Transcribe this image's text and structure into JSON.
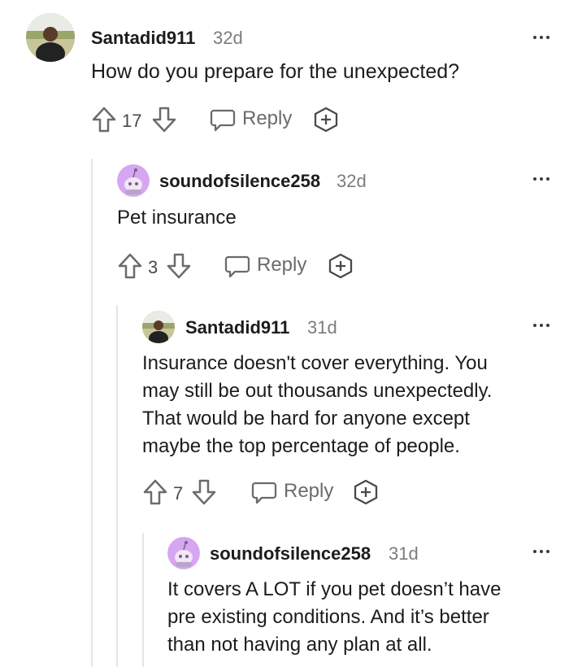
{
  "comments": [
    {
      "username": "Santadid911",
      "age": "32d",
      "body": "How do you prepare for the unexpected?",
      "votes": "17",
      "reply_label": "Reply",
      "avatar": "photo-avatar"
    },
    {
      "username": "soundofsilence258",
      "age": "32d",
      "body": "Pet insurance",
      "votes": "3",
      "reply_label": "Reply",
      "avatar": "snoo-avatar"
    },
    {
      "username": "Santadid911",
      "age": "31d",
      "body": "Insurance doesn't cover everything. You\nmay still be out thousands unexpectedly.\nThat would be hard for anyone except\nmaybe the top percentage of people.",
      "votes": "7",
      "reply_label": "Reply",
      "avatar": "photo-avatar"
    },
    {
      "username": "soundofsilence258",
      "age": "31d",
      "body": "It covers A LOT if you pet doesn’t have\npre existing conditions. And it’s better\nthan not having any plan at all.",
      "avatar": "snoo-avatar"
    }
  ],
  "colors": {
    "text": "#1c1c1c",
    "meta": "#7c7c7c",
    "icon": "#6b6b6b",
    "thread_line": "#e4e6e8",
    "snoo_bg": "#d6a6f0"
  }
}
